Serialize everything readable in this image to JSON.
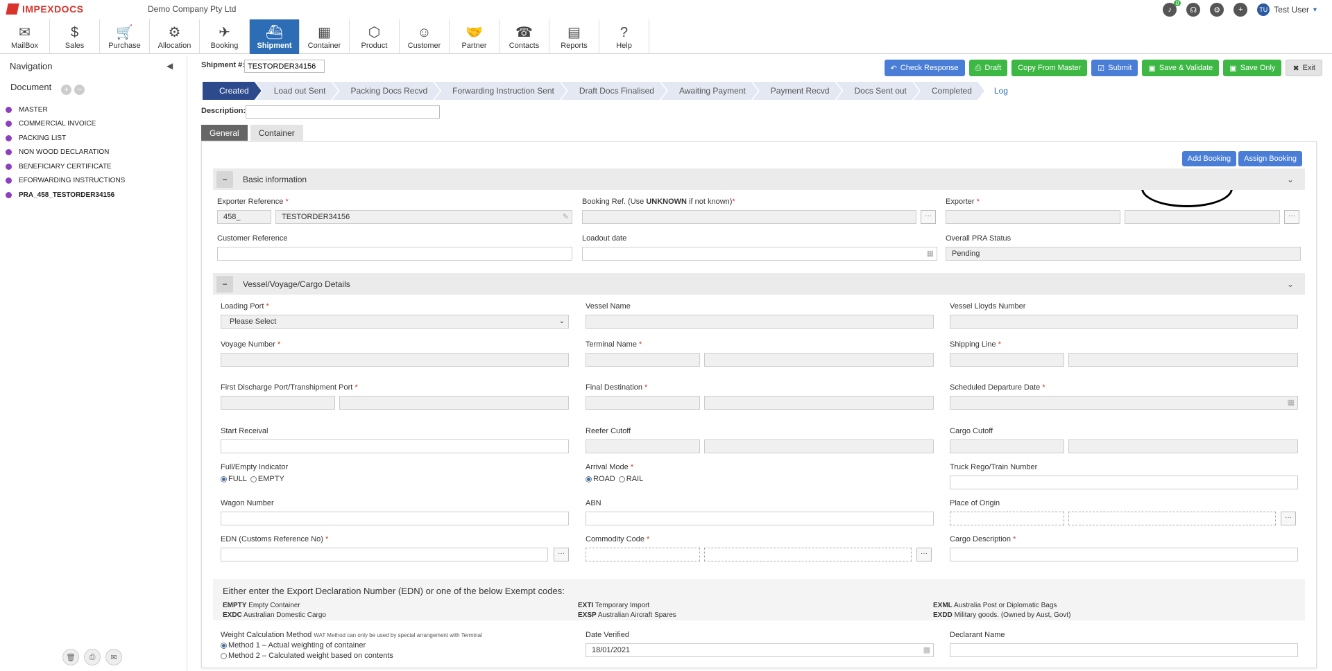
{
  "app": {
    "logo": "IMPEXDOCS",
    "company": "Demo Company Pty Ltd",
    "notif_count": "0",
    "user_initials": "TU",
    "user_name": "Test User"
  },
  "modules": [
    {
      "label": "MailBox",
      "icon": "mailbox-icon",
      "glyph": "✉"
    },
    {
      "label": "Sales",
      "icon": "dollar-icon",
      "glyph": "$"
    },
    {
      "label": "Purchase",
      "icon": "cart-icon",
      "glyph": "🛒"
    },
    {
      "label": "Allocation",
      "icon": "allocation-icon",
      "glyph": "⚙"
    },
    {
      "label": "Booking",
      "icon": "plane-icon",
      "glyph": "✈"
    },
    {
      "label": "Shipment",
      "icon": "ship-icon",
      "glyph": "⛴"
    },
    {
      "label": "Container",
      "icon": "container-icon",
      "glyph": "▦"
    },
    {
      "label": "Product",
      "icon": "box-icon",
      "glyph": "⬡"
    },
    {
      "label": "Customer",
      "icon": "user-icon",
      "glyph": "☺"
    },
    {
      "label": "Partner",
      "icon": "handshake-icon",
      "glyph": "🤝"
    },
    {
      "label": "Contacts",
      "icon": "phone-icon",
      "glyph": "☎"
    },
    {
      "label": "Reports",
      "icon": "report-icon",
      "glyph": "▤"
    },
    {
      "label": "Help",
      "icon": "help-icon",
      "glyph": "?"
    }
  ],
  "sidebar": {
    "title": "Navigation",
    "doc_title": "Document",
    "documents": [
      "MASTER",
      "COMMERCIAL INVOICE",
      "PACKING LIST",
      "NON WOOD DECLARATION",
      "BENEFICIARY CERTIFICATE",
      "EFORWARDING INSTRUCTIONS",
      "PRA_458_TESTORDER34156"
    ]
  },
  "shipment": {
    "label": "Shipment #:",
    "value": "TESTORDER34156",
    "description_label": "Description:",
    "description_value": ""
  },
  "actions": [
    "Check Response",
    "Draft",
    "Copy From Master",
    "Submit",
    "Save & Validate",
    "Save Only",
    "Exit"
  ],
  "steps": [
    "Created",
    "Load out Sent",
    "Packing Docs Recvd",
    "Forwarding Instruction Sent",
    "Draft Docs Finalised",
    "Awaiting Payment",
    "Payment Recvd",
    "Docs Sent out",
    "Completed"
  ],
  "log_label": "Log",
  "tabs": [
    "General",
    "Container"
  ],
  "panel_buttons": [
    "Add Booking",
    "Assign Booking"
  ],
  "basic": {
    "title": "Basic information",
    "exporter_ref_label": "Exporter Reference",
    "exporter_ref_prefix": "458_",
    "exporter_ref_value": "TESTORDER34156",
    "booking_ref_label_a": "Booking Ref. (Use ",
    "booking_ref_label_b": "UNKNOWN",
    "booking_ref_label_c": " if not known)",
    "exporter_label": "Exporter",
    "customer_ref_label": "Customer Reference",
    "loadout_label": "Loadout date",
    "pra_status_label": "Overall PRA Status",
    "pra_status_value": "Pending"
  },
  "vessel": {
    "title": "Vessel/Voyage/Cargo Details",
    "loading_port": "Loading Port",
    "loading_port_value": "Please Select",
    "vessel_name": "Vessel Name",
    "vessel_lloyds": "Vessel Lloyds Number",
    "voyage_number": "Voyage Number",
    "terminal_name": "Terminal Name",
    "shipping_line": "Shipping Line",
    "first_discharge": "First Discharge Port/Transhipment Port",
    "final_destination": "Final Destination",
    "scheduled_departure": "Scheduled Departure Date",
    "start_receival": "Start Receival",
    "reefer_cutoff": "Reefer Cutoff",
    "cargo_cutoff": "Cargo Cutoff",
    "full_empty": "Full/Empty Indicator",
    "full": "FULL",
    "empty": "EMPTY",
    "arrival_mode": "Arrival Mode",
    "road": "ROAD",
    "rail": "RAIL",
    "truck_rego": "Truck Rego/Train Number",
    "wagon_number": "Wagon Number",
    "abn": "ABN",
    "place_of_origin": "Place of Origin",
    "edn": "EDN (Customs Reference No)",
    "commodity_code": "Commodity Code",
    "cargo_description": "Cargo Description"
  },
  "exempt": {
    "title": "Either enter the Export Declaration Number (EDN) or one of the below Exempt codes:",
    "codes": [
      {
        "code": "EMPTY",
        "desc": "Empty Container"
      },
      {
        "code": "EXDC",
        "desc": "Australian Domestic Cargo"
      },
      {
        "code": "EXTI",
        "desc": "Temporary Import"
      },
      {
        "code": "EXSP",
        "desc": "Australian Aircraft Spares"
      },
      {
        "code": "EXML",
        "desc": "Australia Post or Diplomatic Bags"
      },
      {
        "code": "EXDD",
        "desc": "Military goods. (Owned by Aust, Govt)"
      }
    ]
  },
  "weight": {
    "label": "Weight Calculation Method",
    "note": "WAT Method can only be used by special arrangement with Terminal",
    "method1": "Method 1 – Actual weighting of container",
    "method2": "Method 2 – Calculated weight based on contents",
    "date_verified": "Date Verified",
    "date_verified_value": "18/01/2021",
    "declarant_name": "Declarant Name"
  }
}
